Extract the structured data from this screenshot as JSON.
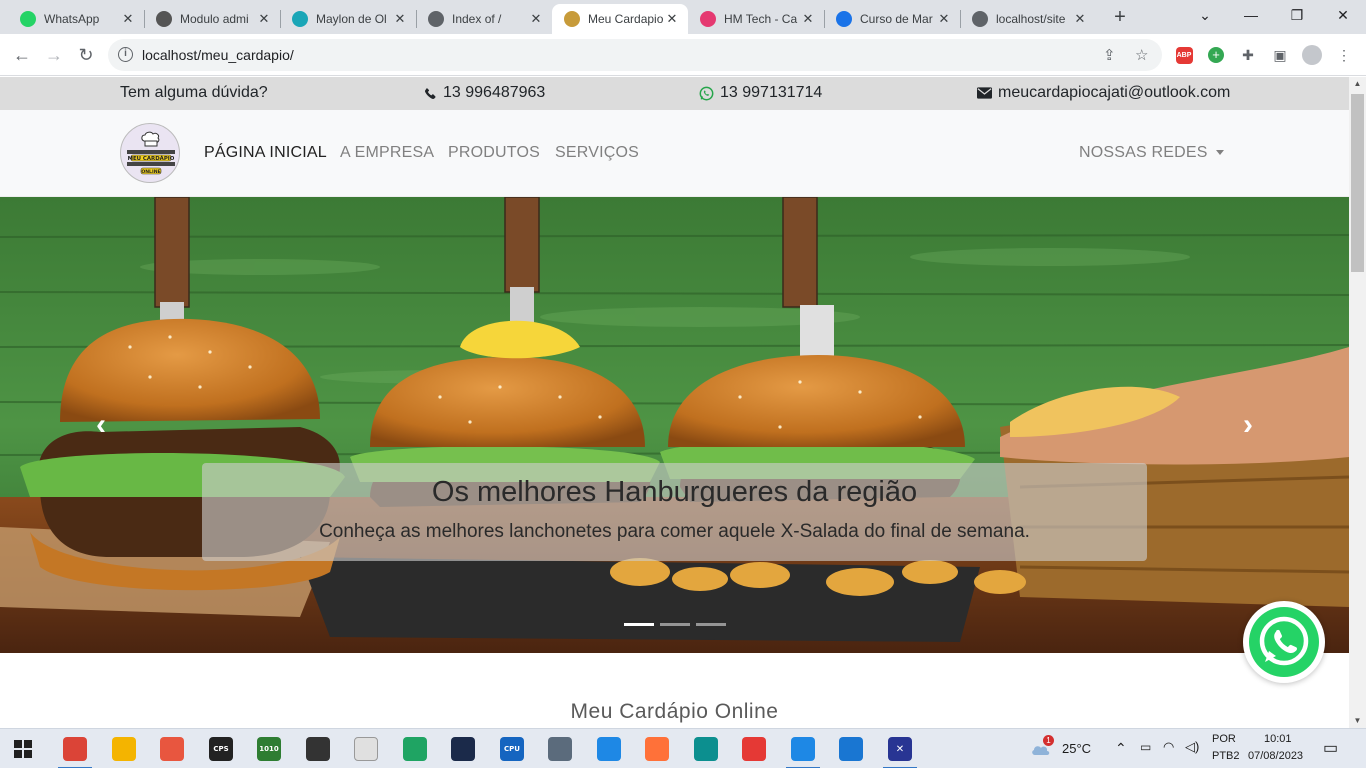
{
  "browser": {
    "tabs": [
      {
        "title": "WhatsApp",
        "icon": "whatsapp-icon",
        "color": "#25d366"
      },
      {
        "title": "Modulo admi",
        "icon": "modulo-icon",
        "color": "#555555"
      },
      {
        "title": "Maylon de Ol",
        "icon": "maylon-icon",
        "color": "#1aa6b7"
      },
      {
        "title": "Index of /",
        "icon": "globe-icon",
        "color": "#5f6368"
      },
      {
        "title": "Meu Cardapio",
        "icon": "cardapio-icon",
        "color": "#c79b3a"
      },
      {
        "title": "HM Tech - Ca",
        "icon": "hmtech-icon",
        "color": "#e53971"
      },
      {
        "title": "Curso de Mar",
        "icon": "curso-icon",
        "color": "#1a73e8"
      },
      {
        "title": "localhost/site",
        "icon": "globe-icon",
        "color": "#5f6368"
      }
    ],
    "active_tab": 4,
    "url": "localhost/meu_cardapio/"
  },
  "site": {
    "topbar": {
      "question": "Tem alguma dúvida?",
      "phone": "13 996487963",
      "whatsapp": "13 997131714",
      "email": "meucardapiocajati@outlook.com"
    },
    "logo_text": {
      "line1": "MEU CARDÁPIO",
      "line2": "ONLINE"
    },
    "nav": {
      "home": "PÁGINA INICIAL",
      "company": "A EMPRESA",
      "products": "PRODUTOS",
      "services": "SERVIÇOS",
      "social": "NOSSAS REDES"
    },
    "carousel": {
      "title": "Os melhores Hanburgueres da região",
      "subtitle": "Conheça as melhores lanchonetes para comer aquele X-Salada do final de semana.",
      "prev": "‹",
      "next": "›",
      "slide_count": 3,
      "active_slide": 0
    },
    "section_title": "Meu Cardápio Online"
  },
  "taskbar": {
    "weather": "25°C",
    "weather_badge": "1",
    "lang1": "POR",
    "lang2": "PTB2",
    "time": "10:01",
    "date": "07/08/2023",
    "apps": [
      {
        "icon": "chrome-icon",
        "glyph": "",
        "color": "#db4437",
        "running": true
      },
      {
        "icon": "file-explorer-icon",
        "glyph": "",
        "color": "#f4b400",
        "running": false
      },
      {
        "icon": "paint-icon",
        "glyph": "",
        "color": "#e8563f",
        "running": false
      },
      {
        "icon": "cps-icon",
        "glyph": "CPS",
        "color": "#222222",
        "running": false
      },
      {
        "icon": "binary-icon",
        "glyph": "1010",
        "color": "#2e7d32",
        "running": false
      },
      {
        "icon": "usb-icon",
        "glyph": "",
        "color": "#333333",
        "running": false
      },
      {
        "icon": "notepad-icon",
        "glyph": "",
        "color": "#e0e0e0",
        "running": false
      },
      {
        "icon": "spreadsheet-icon",
        "glyph": "",
        "color": "#1fa463",
        "running": false
      },
      {
        "icon": "keyboard-icon",
        "glyph": "",
        "color": "#1b2a4a",
        "running": false
      },
      {
        "icon": "cpu-icon",
        "glyph": "CPU",
        "color": "#1565c0",
        "running": false
      },
      {
        "icon": "calculator-icon",
        "glyph": "",
        "color": "#5b6b7c",
        "running": false
      },
      {
        "icon": "chrome-blue-icon",
        "glyph": "",
        "color": "#1e88e5",
        "running": false
      },
      {
        "icon": "firefox-icon",
        "glyph": "",
        "color": "#ff7139",
        "running": false
      },
      {
        "icon": "edge-icon",
        "glyph": "",
        "color": "#0c8f8f",
        "running": false
      },
      {
        "icon": "kite-icon",
        "glyph": "",
        "color": "#e53935",
        "running": false
      },
      {
        "icon": "vscode-icon",
        "glyph": "",
        "color": "#1e88e5",
        "running": true
      },
      {
        "icon": "control-panel-icon",
        "glyph": "",
        "color": "#1976d2",
        "running": false
      },
      {
        "icon": "xampp-icon",
        "glyph": "✕",
        "color": "#283593",
        "running": true
      }
    ]
  }
}
